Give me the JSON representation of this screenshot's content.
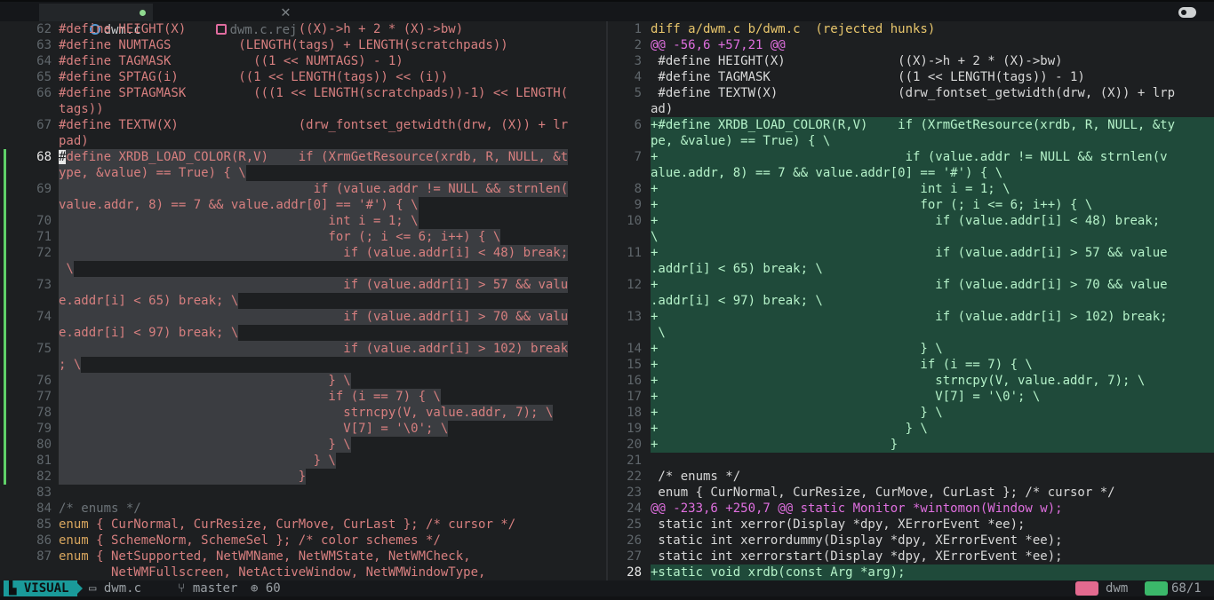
{
  "tabs": [
    {
      "label": "dwm.c",
      "modified": true
    },
    {
      "label": "dwm.c.rej"
    }
  ],
  "left": {
    "lines": [
      {
        "n": "62",
        "t": "#define HEIGHT(X)               ((X)->h + 2 * (X)->bw)"
      },
      {
        "n": "63",
        "t": "#define NUMTAGS         (LENGTH(tags) + LENGTH(scratchpads))"
      },
      {
        "n": "64",
        "t": "#define TAGMASK           ((1 << NUMTAGS) - 1)"
      },
      {
        "n": "65",
        "t": "#define SPTAG(i)        ((1 << LENGTH(tags)) << (i))"
      },
      {
        "n": "66",
        "t": "#define SPTAGMASK         (((1 << LENGTH(scratchpads))-1) << LENGTH("
      },
      {
        "n": "",
        "t": "tags))"
      },
      {
        "n": "67",
        "t": "#define TEXTW(X)                (drw_fontset_getwidth(drw, (X)) + lr"
      },
      {
        "n": "",
        "t": "pad)"
      },
      {
        "n": "68",
        "t": "#define XRDB_LOAD_COLOR(R,V)    if (XrmGetResource(xrdb, R, NULL, &t",
        "sel": true,
        "sign": true,
        "cur": true
      },
      {
        "n": "",
        "t": "ype, &value) == True) { \\",
        "sel": true,
        "sign": true
      },
      {
        "n": "69",
        "t": "                                  if (value.addr != NULL && strnlen(",
        "sel": true,
        "sign": true
      },
      {
        "n": "",
        "t": "value.addr, 8) == 7 && value.addr[0] == '#') { \\",
        "sel": true,
        "sign": true
      },
      {
        "n": "70",
        "t": "                                    int i = 1; \\",
        "sel": true,
        "sign": true
      },
      {
        "n": "71",
        "t": "                                    for (; i <= 6; i++) { \\",
        "sel": true,
        "sign": true
      },
      {
        "n": "72",
        "t": "                                      if (value.addr[i] < 48) break;",
        "sel": true,
        "sign": true
      },
      {
        "n": "",
        "t": " \\",
        "sel": true,
        "sign": true
      },
      {
        "n": "73",
        "t": "                                      if (value.addr[i] > 57 && valu",
        "sel": true,
        "sign": true
      },
      {
        "n": "",
        "t": "e.addr[i] < 65) break; \\",
        "sel": true,
        "sign": true
      },
      {
        "n": "74",
        "t": "                                      if (value.addr[i] > 70 && valu",
        "sel": true,
        "sign": true
      },
      {
        "n": "",
        "t": "e.addr[i] < 97) break; \\",
        "sel": true,
        "sign": true
      },
      {
        "n": "75",
        "t": "                                      if (value.addr[i] > 102) break",
        "sel": true,
        "sign": true
      },
      {
        "n": "",
        "t": "; \\",
        "sel": true,
        "sign": true
      },
      {
        "n": "76",
        "t": "                                    } \\",
        "sel": true,
        "sign": true
      },
      {
        "n": "77",
        "t": "                                    if (i == 7) { \\",
        "sel": true,
        "sign": true
      },
      {
        "n": "78",
        "t": "                                      strncpy(V, value.addr, 7); \\",
        "sel": true,
        "sign": true
      },
      {
        "n": "79",
        "t": "                                      V[7] = '\\0'; \\",
        "sel": true,
        "sign": true
      },
      {
        "n": "80",
        "t": "                                    } \\",
        "sel": true,
        "sign": true
      },
      {
        "n": "81",
        "t": "                                  } \\",
        "sel": true,
        "sign": true
      },
      {
        "n": "82",
        "t": "                                }",
        "sel": true,
        "sign": true
      },
      {
        "n": "83",
        "t": ""
      },
      {
        "n": "84",
        "t": "/* enums */",
        "cls": "cmt"
      },
      {
        "n": "85",
        "t": "enum { CurNormal, CurResize, CurMove, CurLast }; /* cursor */"
      },
      {
        "n": "86",
        "t": "enum { SchemeNorm, SchemeSel }; /* color schemes */"
      },
      {
        "n": "87",
        "t": "enum { NetSupported, NetWMName, NetWMState, NetWMCheck,"
      },
      {
        "n": "",
        "t": "       NetWMFullscreen, NetActiveWindow, NetWMWindowType,"
      }
    ]
  },
  "right": {
    "lines": [
      {
        "n": "1",
        "t": "diff a/dwm.c b/dwm.c  (rejected hunks)",
        "cls": "hdr"
      },
      {
        "n": "2",
        "t": "@@ -56,6 +57,21 @@",
        "cls": "hunk"
      },
      {
        "n": "3",
        "t": " #define HEIGHT(X)               ((X)->h + 2 * (X)->bw)"
      },
      {
        "n": "4",
        "t": " #define TAGMASK                 ((1 << LENGTH(tags)) - 1)"
      },
      {
        "n": "5",
        "t": " #define TEXTW(X)                (drw_fontset_getwidth(drw, (X)) + lrp"
      },
      {
        "n": "",
        "t": "ad)"
      },
      {
        "n": "6",
        "t": "+#define XRDB_LOAD_COLOR(R,V)    if (XrmGetResource(xrdb, R, NULL, &ty",
        "add": true
      },
      {
        "n": "",
        "t": "pe, &value) == True) { \\",
        "add": true
      },
      {
        "n": "7",
        "t": "+                                 if (value.addr != NULL && strnlen(v",
        "add": true
      },
      {
        "n": "",
        "t": "alue.addr, 8) == 7 && value.addr[0] == '#') { \\",
        "add": true
      },
      {
        "n": "8",
        "t": "+                                   int i = 1; \\",
        "add": true
      },
      {
        "n": "9",
        "t": "+                                   for (; i <= 6; i++) { \\",
        "add": true
      },
      {
        "n": "10",
        "t": "+                                     if (value.addr[i] < 48) break;",
        "add": true
      },
      {
        "n": "",
        "t": "\\",
        "add": true
      },
      {
        "n": "11",
        "t": "+                                     if (value.addr[i] > 57 && value",
        "add": true
      },
      {
        "n": "",
        "t": ".addr[i] < 65) break; \\",
        "add": true
      },
      {
        "n": "12",
        "t": "+                                     if (value.addr[i] > 70 && value",
        "add": true
      },
      {
        "n": "",
        "t": ".addr[i] < 97) break; \\",
        "add": true
      },
      {
        "n": "13",
        "t": "+                                     if (value.addr[i] > 102) break;",
        "add": true
      },
      {
        "n": "",
        "t": " \\",
        "add": true
      },
      {
        "n": "14",
        "t": "+                                   } \\",
        "add": true
      },
      {
        "n": "15",
        "t": "+                                   if (i == 7) { \\",
        "add": true
      },
      {
        "n": "16",
        "t": "+                                     strncpy(V, value.addr, 7); \\",
        "add": true
      },
      {
        "n": "17",
        "t": "+                                     V[7] = '\\0'; \\",
        "add": true
      },
      {
        "n": "18",
        "t": "+                                   } \\",
        "add": true
      },
      {
        "n": "19",
        "t": "+                                 } \\",
        "add": true
      },
      {
        "n": "20",
        "t": "+                               }",
        "add": true
      },
      {
        "n": "21",
        "t": ""
      },
      {
        "n": "22",
        "t": " /* enums */"
      },
      {
        "n": "23",
        "t": " enum { CurNormal, CurResize, CurMove, CurLast }; /* cursor */"
      },
      {
        "n": "24",
        "t": "@@ -233,6 +250,7 @@ static Monitor *wintomon(Window w);",
        "cls": "hunk"
      },
      {
        "n": "25",
        "t": " static int xerror(Display *dpy, XErrorEvent *ee);"
      },
      {
        "n": "26",
        "t": " static int xerrordummy(Display *dpy, XErrorEvent *ee);"
      },
      {
        "n": "27",
        "t": " static int xerrorstart(Display *dpy, XErrorEvent *ee);"
      },
      {
        "n": "28",
        "t": "+static void xrdb(const Arg *arg);",
        "add": true,
        "cur": true
      }
    ]
  },
  "status": {
    "mode": "VISUAL",
    "file": "dwm.c",
    "branch": "master",
    "changes": "60",
    "filetype": "dwm",
    "position": "68/1"
  }
}
